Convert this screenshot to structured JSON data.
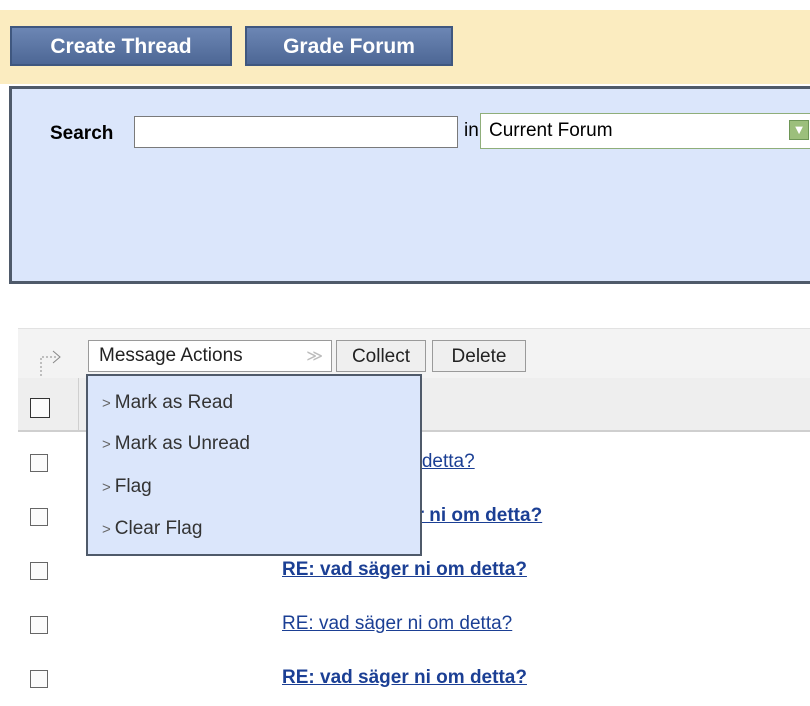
{
  "actionbar": {
    "create_thread": "Create Thread",
    "grade_forum": "Grade Forum"
  },
  "search": {
    "label": "Search",
    "value": "",
    "in_label": "in",
    "scope_selected": "Current Forum"
  },
  "toolbar": {
    "message_actions": "Message Actions",
    "collect": "Collect",
    "delete": "Delete"
  },
  "menu": {
    "items": [
      "Mark as Read",
      "Mark as Unread",
      "Flag",
      "Clear Flag"
    ]
  },
  "rows": [
    {
      "subject": "RE: vad säger ni om detta?",
      "visible_text": "n detta?",
      "unread": false
    },
    {
      "subject": "RE: vad säger ni om detta?",
      "visible_text": "er ni om detta?",
      "unread": true
    },
    {
      "subject": "RE: vad säger ni om detta?",
      "visible_text": "RE: vad säger ni om detta?",
      "unread": true
    },
    {
      "subject": "RE: vad säger ni om detta?",
      "visible_text": "RE: vad säger ni om detta?",
      "unread": false
    },
    {
      "subject": "RE: vad säger ni om detta?",
      "visible_text": "RE: vad säger ni om detta?",
      "unread": true
    }
  ],
  "colors": {
    "action_bar_bg": "#fbecc0",
    "button_blue": "#5a74a3",
    "panel_bg": "#dbe6fb",
    "link": "#1b3f94"
  }
}
